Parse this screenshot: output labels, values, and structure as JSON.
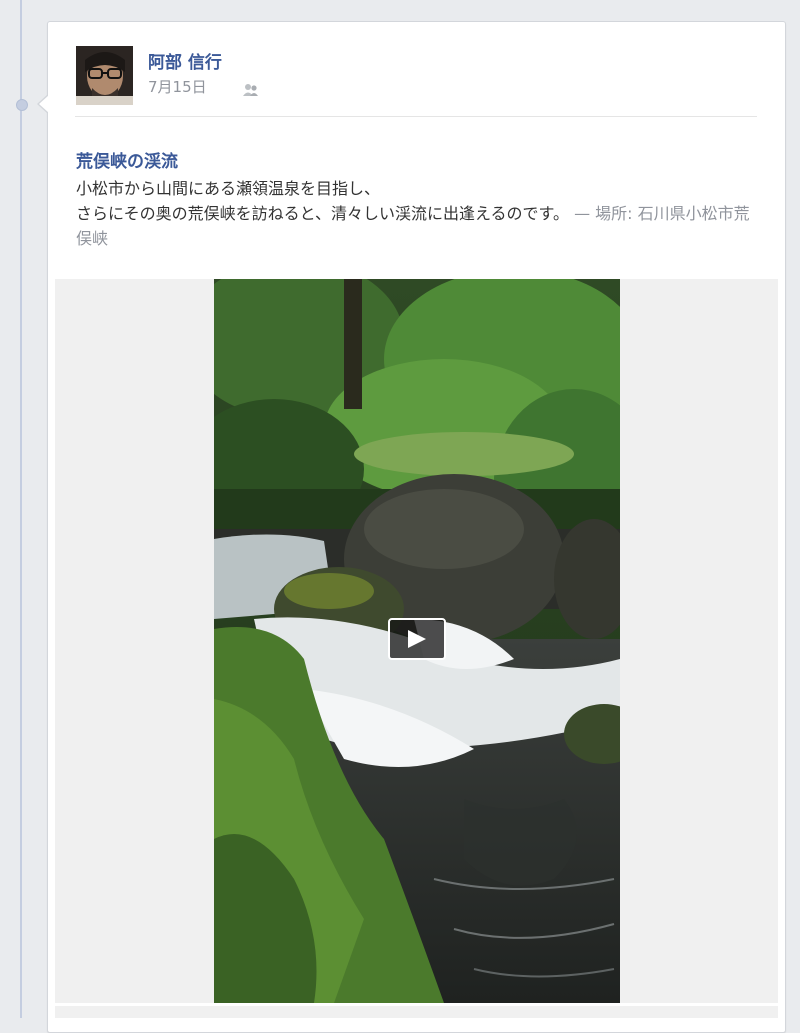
{
  "post": {
    "author": "阿部 信行",
    "date": "7月15日",
    "title": "荒俣峡の渓流",
    "body_line1": "小松市から山間にある瀬領温泉を目指し、",
    "body_line2": "さらにその奥の荒俣峡を訪ねると、清々しい渓流に出逢えるのです。",
    "location_prefix": "— 場所: ",
    "location": "石川県小松市荒俣峡"
  },
  "icons": {
    "audience": "friends-icon",
    "play": "play-icon"
  },
  "colors": {
    "link": "#3b5998",
    "meta": "#90949c",
    "background": "#e9ebee"
  }
}
